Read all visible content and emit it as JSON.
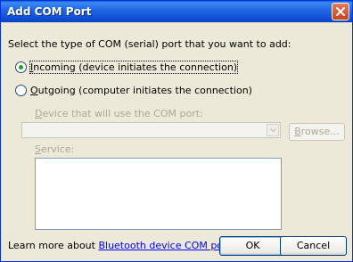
{
  "window": {
    "title": "Add COM Port"
  },
  "instruction": "Select the type of COM (serial) port that you want to add:",
  "incoming": {
    "accel": "I",
    "rest": "ncoming (device initiates the connection)",
    "checked": true
  },
  "outgoing": {
    "accel": "O",
    "rest": "utgoing (computer initiates the connection)",
    "checked": false
  },
  "device_label": {
    "accel": "D",
    "rest": "evice that will use the COM port:"
  },
  "browse": {
    "accel": "B",
    "rest": "rowse..."
  },
  "service_label": {
    "accel": "S",
    "rest": "ervice:"
  },
  "learn_more": {
    "prefix": "Learn more about ",
    "link": "Bluetooth device COM ports",
    "suffix": "."
  },
  "buttons": {
    "ok": "OK",
    "cancel": "Cancel"
  }
}
